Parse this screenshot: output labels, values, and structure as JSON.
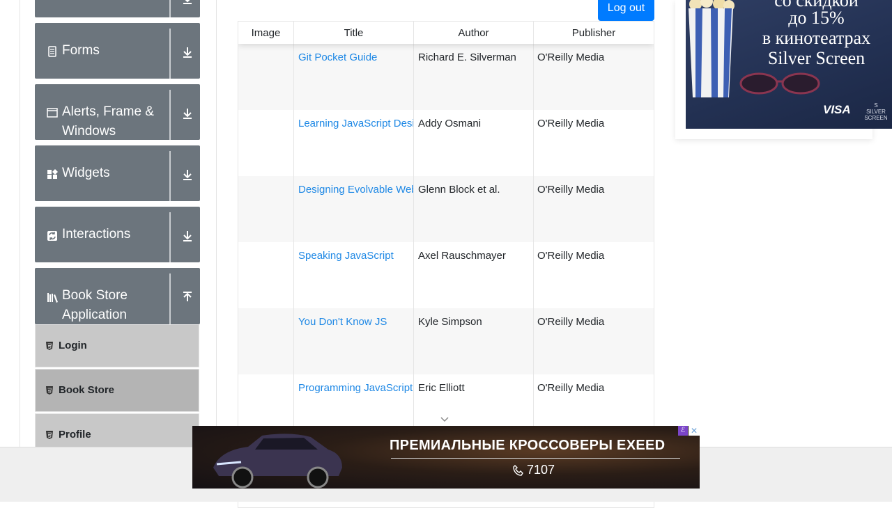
{
  "sidebar": {
    "groups": [
      {
        "label": "Forms",
        "icon": "form-icon",
        "arrow": "download-arrow-icon"
      },
      {
        "label": "Alerts, Frame &",
        "label2": "Windows",
        "icon": "window-icon",
        "arrow": "download-arrow-icon"
      },
      {
        "label": "Widgets",
        "icon": "widgets-icon",
        "arrow": "download-arrow-icon"
      },
      {
        "label": "Interactions",
        "icon": "interactions-icon",
        "arrow": "download-arrow-icon"
      },
      {
        "label": "Book Store",
        "label2": "Application",
        "icon": "books-icon",
        "arrow": "upload-arrow-icon"
      }
    ],
    "subitems": [
      {
        "label": "Login",
        "icon": "html5-icon",
        "active": false
      },
      {
        "label": "Book Store",
        "icon": "html5-icon",
        "active": true
      },
      {
        "label": "Profile",
        "icon": "html5-icon",
        "active": false
      }
    ]
  },
  "header": {
    "logout_label": "Log out"
  },
  "table": {
    "columns": [
      "Image",
      "Title",
      "Author",
      "Publisher"
    ],
    "rows": [
      {
        "title": "Git Pocket Guide",
        "author": "Richard E. Silverman",
        "publisher": "O'Reilly Media"
      },
      {
        "title": "Learning JavaScript Design Patterns",
        "author": "Addy Osmani",
        "publisher": "O'Reilly Media"
      },
      {
        "title": "Designing Evolvable Web APIs with ASP.NET",
        "author": "Glenn Block et al.",
        "publisher": "O'Reilly Media"
      },
      {
        "title": "Speaking JavaScript",
        "author": "Axel Rauschmayer",
        "publisher": "O'Reilly Media"
      },
      {
        "title": "You Don't Know JS",
        "author": "Kyle Simpson",
        "publisher": "O'Reilly Media"
      },
      {
        "title": "Programming JavaScript Applications",
        "author": "Eric Elliott",
        "publisher": "O'Reilly Media"
      }
    ]
  },
  "side_ad": {
    "lines": [
      "со скидкой",
      "до 15%",
      "в кинотеатрах",
      "Silver Screen"
    ],
    "visa": "VISA",
    "logo": "SILVER SCREEN"
  },
  "banner": {
    "headline": "ПРЕМИАЛЬНЫЕ КРОССОВЕРЫ EXEED",
    "phone": "7107",
    "badge": "ℰ",
    "close": "✕"
  },
  "colors": {
    "accent": "#007bff",
    "link": "#1e88e5",
    "sidebar_group": "#6c757d"
  }
}
